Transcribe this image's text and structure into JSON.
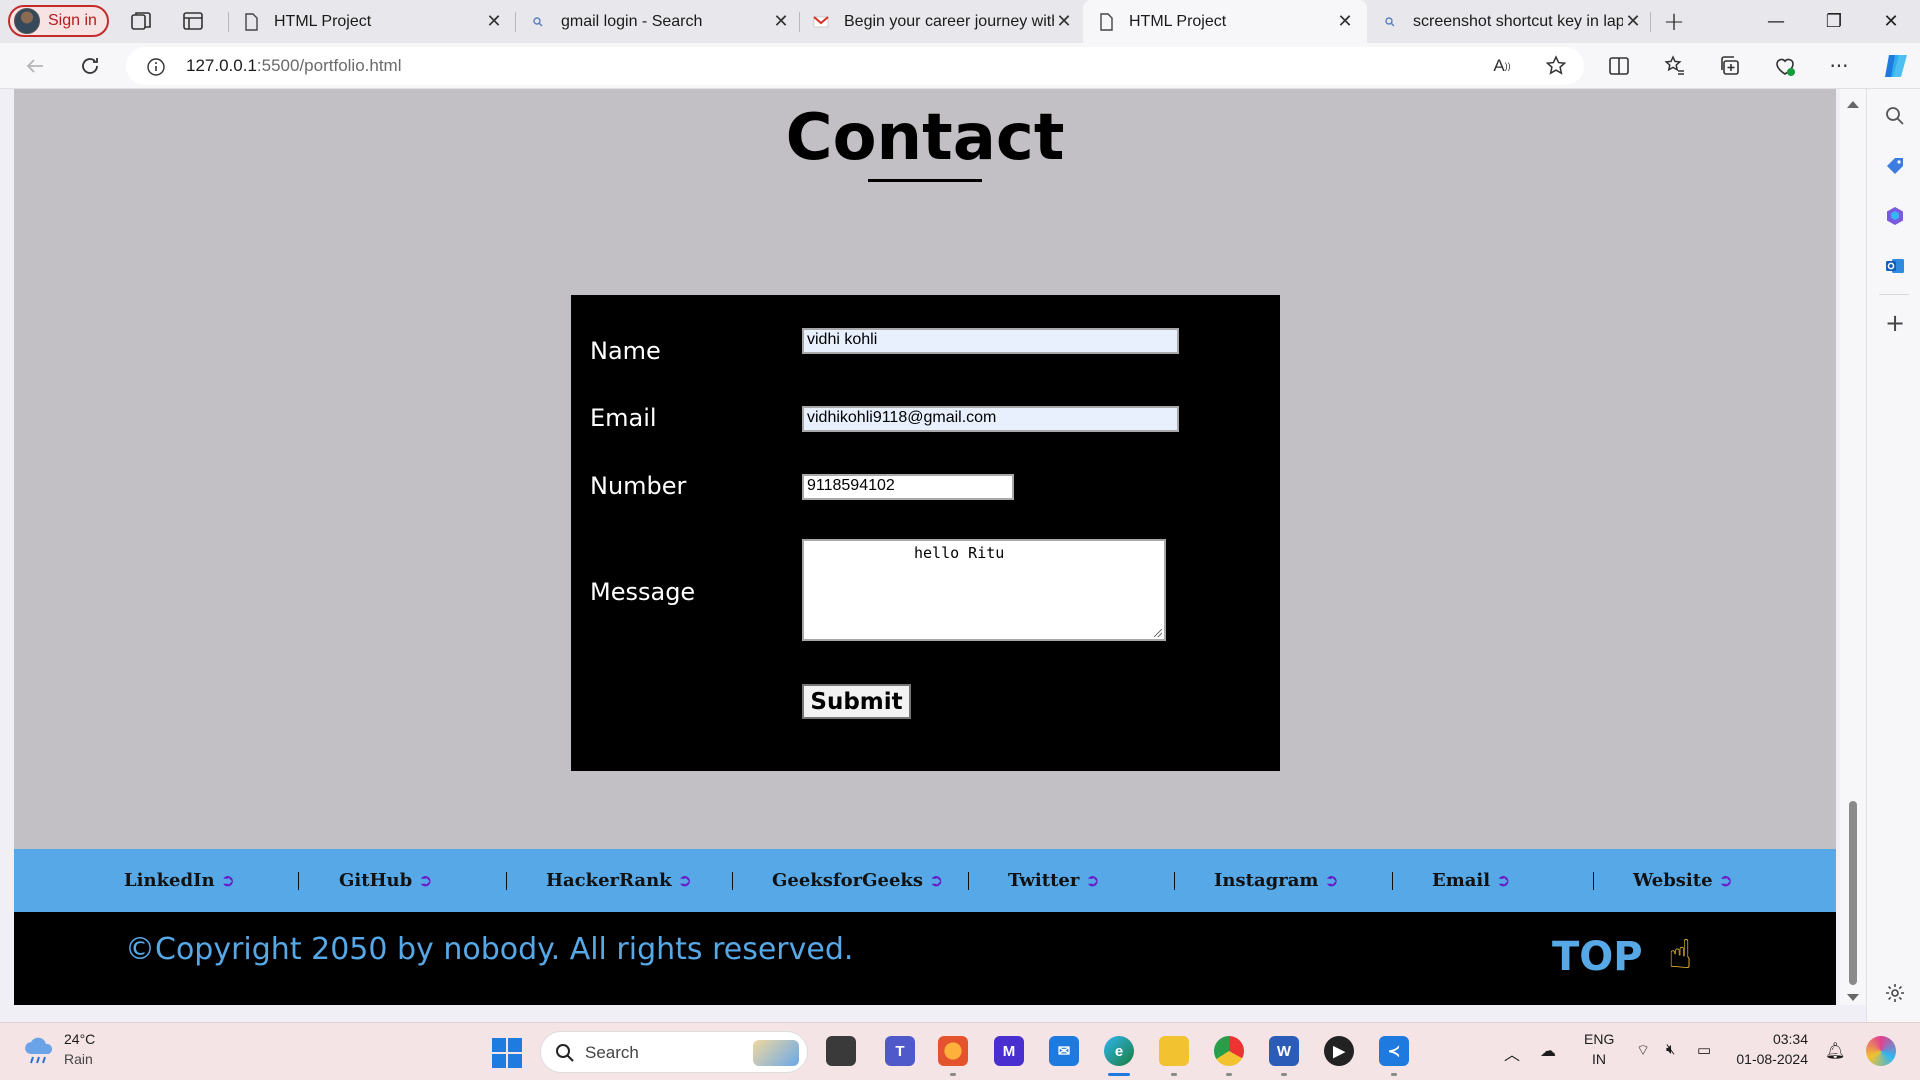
{
  "browser": {
    "signin_label": "Sign in",
    "tabs": [
      {
        "title": "HTML Project",
        "favicon": "page-icon"
      },
      {
        "title": "gmail login - Search",
        "favicon": "search-icon"
      },
      {
        "title": "Begin your career journey with",
        "favicon": "gmail-icon"
      },
      {
        "title": "HTML Project",
        "favicon": "page-icon",
        "active": true
      },
      {
        "title": "screenshot shortcut key in lapt",
        "favicon": "search-icon"
      }
    ],
    "url_host": "127.0.0.1",
    "url_path": ":5500/portfolio.html"
  },
  "page": {
    "title": "Contact",
    "form": {
      "name_label": "Name",
      "name_value": "vidhi kohli",
      "email_label": "Email",
      "email_value": "vidhikohli9118@gmail.com",
      "number_label": "Number",
      "number_value": "9118594102",
      "message_label": "Message",
      "message_value": "hello Ritu",
      "submit_label": "Submit"
    },
    "footer_links": [
      {
        "label": "LinkedIn",
        "arrow": "➲"
      },
      {
        "label": "GitHub",
        "arrow": "➲"
      },
      {
        "label": "HackerRank",
        "arrow": "➲"
      },
      {
        "label": "GeeksforGeeks",
        "arrow": "➲"
      },
      {
        "label": "Twitter",
        "arrow": "➲"
      },
      {
        "label": "Instagram",
        "arrow": "➲"
      },
      {
        "label": "Email",
        "arrow": "➲"
      },
      {
        "label": "Website",
        "arrow": "➲"
      }
    ],
    "copyright": "©Copyright 2050 by nobody. All rights reserved.",
    "top_label": "TOP",
    "top_icon": "☝"
  },
  "colors": {
    "page_bg": "#c2c0c5",
    "footer_blue": "#56a8e6",
    "form_bg": "#000000"
  },
  "taskbar": {
    "weather_temp": "24°C",
    "weather_cond": "Rain",
    "search_placeholder": "Search",
    "lang_top": "ENG",
    "lang_bottom": "IN",
    "time": "03:34",
    "date": "01-08-2024"
  }
}
